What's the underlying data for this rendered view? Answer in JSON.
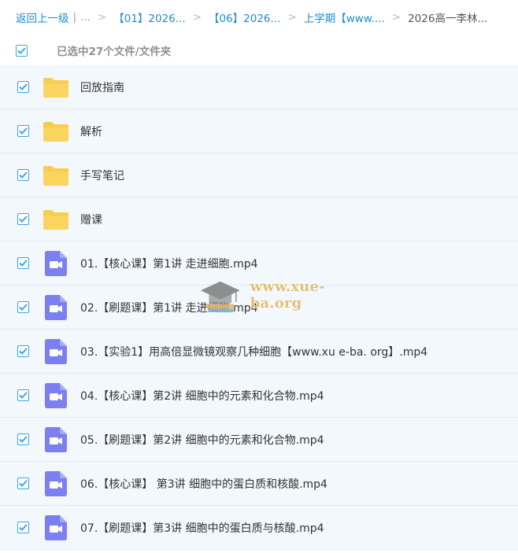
{
  "breadcrumb": {
    "back_label": "返回上一级",
    "divider": "|",
    "ellipsis": "...",
    "sep": ">",
    "crumbs": [
      "【01】2026...",
      "【06】2026...",
      "上学期【www...."
    ],
    "current": "2026高一李林..."
  },
  "selection": {
    "text": "已选中27个文件/文件夹"
  },
  "files": [
    {
      "name": "回放指南",
      "type": "folder"
    },
    {
      "name": "解析",
      "type": "folder"
    },
    {
      "name": "手写笔记",
      "type": "folder"
    },
    {
      "name": "赠课",
      "type": "folder"
    },
    {
      "name": "01.【核心课】第1讲 走进细胞.mp4",
      "type": "video"
    },
    {
      "name": "02.【刷题课】第1讲 走进细胞.mp4",
      "type": "video"
    },
    {
      "name": "03.【实验1】用高倍显微镜观察几种细胞【www.xu e-ba. org】.mp4",
      "type": "video"
    },
    {
      "name": "04.【核心课】第2讲 细胞中的元素和化合物.mp4",
      "type": "video"
    },
    {
      "name": "05.【刷题课】第2讲 细胞中的元素和化合物.mp4",
      "type": "video"
    },
    {
      "name": "06.【核心课】 第3讲 细胞中的蛋白质和核酸.mp4",
      "type": "video"
    },
    {
      "name": "07.【刷题课】第3讲 细胞中的蛋白质与核酸.mp4",
      "type": "video"
    }
  ],
  "watermark": {
    "text": "www.xue-ba.org"
  },
  "colors": {
    "accent": "#1a8cd8",
    "checkbox": "#3fa3e8",
    "folder": "#f8cc4e",
    "video_icon": "#7b7ff0",
    "row_bg": "#f3f8fc",
    "watermark": "#e3bf78"
  },
  "icons": {
    "folder": "folder-icon",
    "video": "video-file-icon",
    "check": "checkmark-icon"
  }
}
